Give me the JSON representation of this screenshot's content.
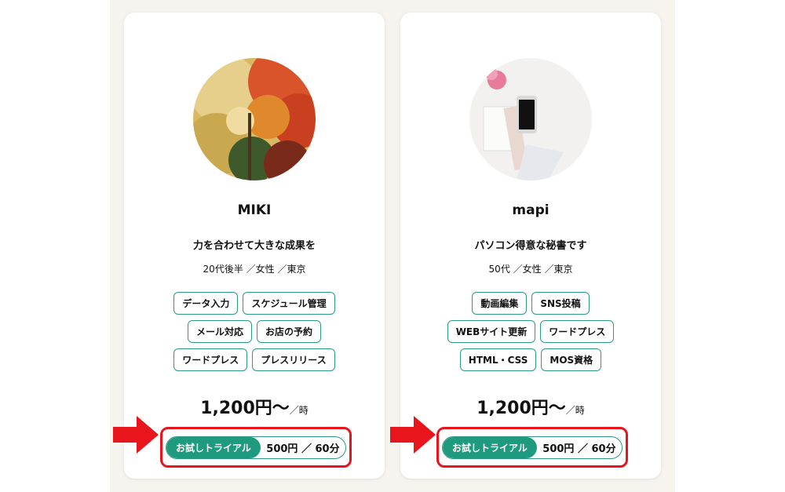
{
  "cards": [
    {
      "name": "MIKI",
      "tagline": "力を合わせて大きな成果を",
      "meta": "20代後半 ／女性 ／東京",
      "avatar_icon": "autumn-leaves-photo",
      "tags": [
        "データ入力",
        "スケジュール管理",
        "メール対応",
        "お店の予約",
        "ワードプレス",
        "プレスリリース"
      ],
      "price": "1,200円〜",
      "price_unit": "／時",
      "trial_label": "お試しトライアル",
      "trial_price": "500円 ／ 60分"
    },
    {
      "name": "mapi",
      "tagline": "パソコン得意な秘書です",
      "meta": "50代 ／女性 ／東京",
      "avatar_icon": "smartphone-desk-photo",
      "tags": [
        "動画編集",
        "SNS投稿",
        "WEBサイト更新",
        "ワードプレス",
        "HTML・CSS",
        "MOS資格"
      ],
      "price": "1,200円〜",
      "price_unit": "／時",
      "trial_label": "お試しトライアル",
      "trial_price": "500円 ／ 60分"
    }
  ],
  "colors": {
    "accent_green": "#1f9a7e",
    "highlight_red": "#e8151c"
  },
  "annotation_icon": "red-arrow-icon"
}
